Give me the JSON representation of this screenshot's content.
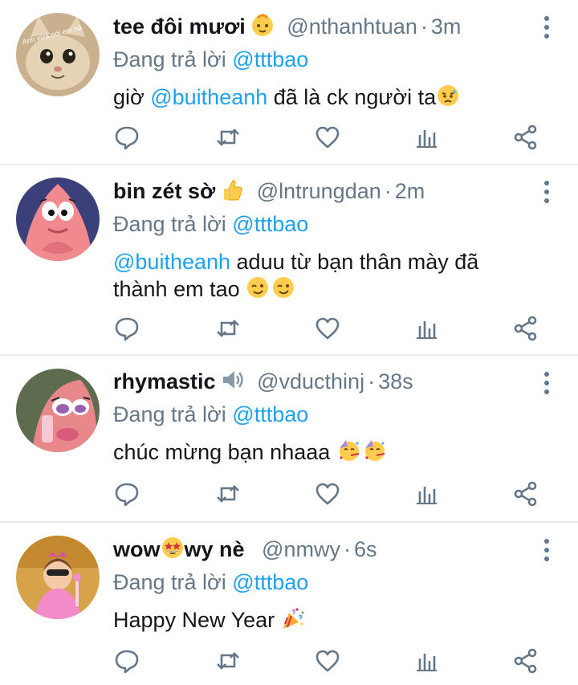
{
  "tweets": [
    {
      "name": "tee đôi mươi",
      "name_emoji": "baby",
      "handle": "@nthanhtuan",
      "time": "3m",
      "reply_prefix": "Đang trả lời",
      "reply_to": "@tttbao",
      "mention": "@buitheanh",
      "text_before": "giờ ",
      "text_after": " đã là ck người ta",
      "body_emojis": [
        "sad-relieved-face"
      ],
      "avatar": "cat",
      "avatar_text": "Anh vừa nói em hả"
    },
    {
      "name": "bin zét sờ",
      "name_emoji": "thumbs-up",
      "handle": "@lntrungdan",
      "time": "2m",
      "reply_prefix": "Đang trả lời",
      "reply_to": "@tttbao",
      "mention": "@buitheanh",
      "text_before": "",
      "text_after": " aduu từ bạn thân mày đã thành em tao ",
      "body_emojis": [
        "winking-face",
        "winking-face"
      ],
      "avatar": "patrick"
    },
    {
      "name": "rhymastic",
      "name_emoji": "speaker",
      "handle": "@vducthinj",
      "time": "38s",
      "reply_prefix": "Đang trả lời",
      "reply_to": "@tttbao",
      "mention": "",
      "text_before": "chúc mừng bạn nhaaa ",
      "text_after": "",
      "body_emojis": [
        "partying-face",
        "partying-face"
      ],
      "avatar": "patrick-lipstick"
    },
    {
      "name_part1": "wow",
      "name_part2": "wy nè",
      "name_emoji": "star-struck",
      "handle": "@nmwy",
      "time": "6s",
      "reply_prefix": "Đang trả lời",
      "reply_to": "@tttbao",
      "mention": "",
      "text_before": "Happy New Year ",
      "text_after": "",
      "body_emojis": [
        "party-popper"
      ],
      "avatar": "girl"
    }
  ],
  "actions": [
    "reply-icon",
    "retweet-icon",
    "like-icon",
    "stats-icon",
    "share-icon"
  ],
  "colors": {
    "link": "#1da1f2",
    "muted": "#657786",
    "divider": "#e6ecf0"
  }
}
